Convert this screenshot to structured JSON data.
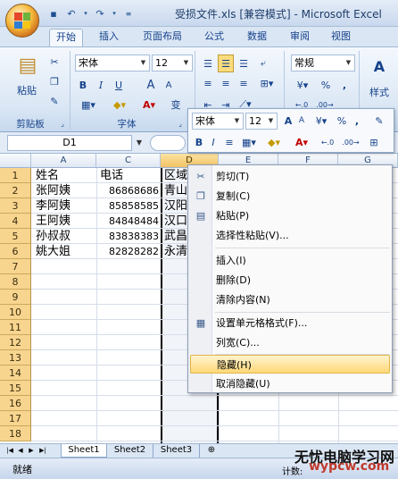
{
  "titlebar": {
    "title": "受损文件.xls  [兼容模式] - Microsoft Excel"
  },
  "tabs": [
    "开始",
    "插入",
    "页面布局",
    "公式",
    "数据",
    "审阅",
    "视图"
  ],
  "ribbon": {
    "clipboard": {
      "paste_label": "粘贴",
      "group_label": "剪贴板"
    },
    "font": {
      "font_name": "宋体",
      "font_size": "12",
      "bold": "B",
      "italic": "I",
      "underline": "U",
      "group_label": "字体",
      "grow": "A",
      "shrink": "A",
      "wen": "变"
    },
    "number": {
      "format": "常规",
      "percent": "%"
    },
    "styles": {
      "label": "样式"
    }
  },
  "formula_bar": {
    "name_box": "D1"
  },
  "columns": [
    "A",
    "C",
    "D",
    "E",
    "F",
    "G"
  ],
  "rows": [
    "1",
    "2",
    "3",
    "4",
    "5",
    "6",
    "7",
    "8",
    "9",
    "10",
    "11",
    "12",
    "13",
    "14",
    "15",
    "16",
    "17",
    "18"
  ],
  "cells": {
    "a": [
      "姓名",
      "张阿姨",
      "李阿姨",
      "王阿姨",
      "孙叔叔",
      "姚大姐"
    ],
    "c": [
      "电话",
      "86868686",
      "85858585",
      "84848484",
      "83838383",
      "82828282"
    ],
    "d": [
      "区域",
      "青山",
      "汉阳",
      "汉口",
      "武昌",
      "永清"
    ]
  },
  "mini_toolbar": {
    "font_name": "宋体",
    "font_size": "12",
    "percent": "%",
    "comma": ","
  },
  "context_menu": {
    "cut": "剪切(T)",
    "copy": "复制(C)",
    "paste": "粘贴(P)",
    "paste_special": "选择性粘贴(V)...",
    "insert": "插入(I)",
    "delete": "删除(D)",
    "clear": "清除内容(N)",
    "format_cells": "设置单元格格式(F)...",
    "col_width": "列宽(C)...",
    "hide": "隐藏(H)",
    "unhide": "取消隐藏(U)"
  },
  "sheets": [
    "Sheet1",
    "Sheet2",
    "Sheet3"
  ],
  "status": {
    "ready": "就绪",
    "count": "计数:"
  },
  "watermark": {
    "line1": "无忧电脑学习网",
    "line2": "wypcw.com"
  },
  "colors": {
    "accent": "#15428b",
    "highlight": "#ffd978",
    "rowheader": "#f8d58f"
  }
}
